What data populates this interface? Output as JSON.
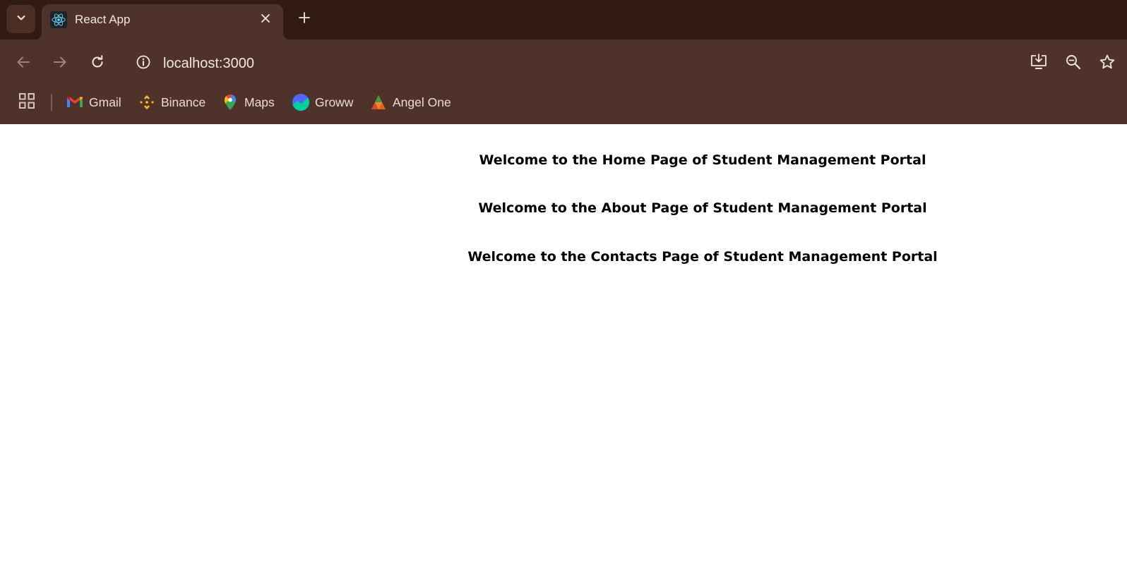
{
  "browser": {
    "tab": {
      "title": "React App",
      "favicon": "react-logo-icon"
    },
    "toolbar": {
      "back_icon": "arrow-left-icon",
      "forward_icon": "arrow-right-icon",
      "reload_icon": "reload-icon",
      "site_info_icon": "info-icon",
      "url": "localhost:3000",
      "install_icon": "install-app-icon",
      "zoom_icon": "zoom-out-icon",
      "bookmark_icon": "star-icon"
    },
    "bookmarks": [
      {
        "label": "Gmail",
        "icon": "gmail-icon"
      },
      {
        "label": "Binance",
        "icon": "binance-icon"
      },
      {
        "label": "Maps",
        "icon": "maps-pin-icon"
      },
      {
        "label": "Groww",
        "icon": "groww-icon"
      },
      {
        "label": "Angel One",
        "icon": "angel-one-icon"
      }
    ],
    "colors": {
      "tabstrip": "#321b13",
      "toolbar": "#4f3229",
      "text": "#f3e7e2"
    }
  },
  "page": {
    "headings": [
      "Welcome to the Home Page of Student Management Portal",
      "Welcome to the About Page of Student Management Portal",
      "Welcome to the Contacts Page of Student Management Portal"
    ]
  }
}
